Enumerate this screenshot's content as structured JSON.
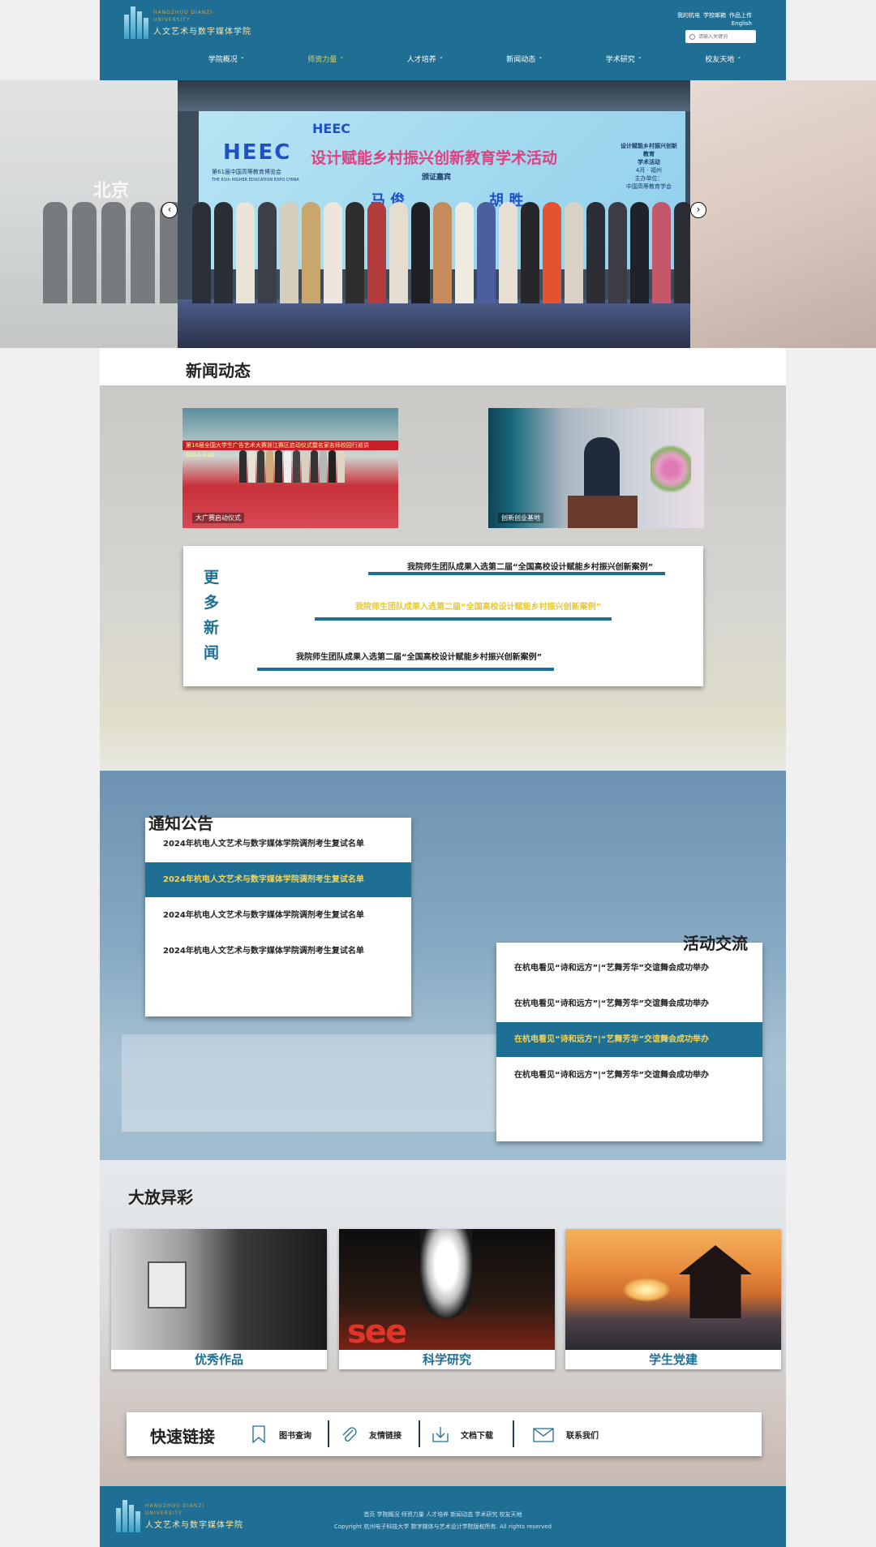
{
  "header": {
    "logo_en_line1": "HANGZHOU DIANZI",
    "logo_en_line2": "UNIVERSITY",
    "logo_cn": "人文艺术与数字媒体学院",
    "top_links": [
      "我的杭电",
      "学校邮箱",
      "作品上传"
    ],
    "lang_switch": "English",
    "search_placeholder": "请输入关键词"
  },
  "nav": {
    "items": [
      {
        "label": "学院概况",
        "active": false
      },
      {
        "label": "师资力量",
        "active": true
      },
      {
        "label": "人才培养",
        "active": false
      },
      {
        "label": "新闻动态",
        "active": false
      },
      {
        "label": "学术研究",
        "active": false
      },
      {
        "label": "校友天地",
        "active": false
      }
    ],
    "caret_icon": "chevron-down-icon"
  },
  "banner": {
    "heec": "HEEC",
    "expo": "第61届中国高等教育博览会",
    "expo_en": "THE 61th HIGHER EDUCATION EXPO CHINA",
    "title": "设计赋能乡村振兴创新教育学术活动",
    "subtitle": "颁证嘉宾",
    "name_1": "马 俊",
    "name_2": "胡 胜",
    "side_text": [
      "设计赋能乡村振兴创新教育",
      "学术活动",
      "4月 · 福州",
      "主办单位：",
      "中国高等教育学会"
    ],
    "left_sign": "北京",
    "prev_icon": "chevron-left-icon",
    "next_icon": "chevron-right-icon"
  },
  "news": {
    "section_title": "新闻动态",
    "image_captions": [
      "大广赛启动仪式",
      "创新创业基地"
    ],
    "image_1_banner": "第16届全国大学生广告艺术大赛浙江赛区启动仪式暨名家名师校园行巡讲 2024.4.16",
    "more_title": "更多新闻",
    "more_items": [
      "我院师生团队成果入选第二届“全国高校设计赋能乡村振兴创新案例”",
      "我院师生团队成果入选第二届“全国高校设计赋能乡村振兴创新案例”",
      "我院师生团队成果入选第二届“全国高校设计赋能乡村振兴创新案例”"
    ]
  },
  "notices": {
    "section_title": "通知公告",
    "items": [
      "2024年杭电人文艺术与数字媒体学院调剂考生复试名单",
      "2024年杭电人文艺术与数字媒体学院调剂考生复试名单",
      "2024年杭电人文艺术与数字媒体学院调剂考生复试名单",
      "2024年杭电人文艺术与数字媒体学院调剂考生复试名单"
    ],
    "active_index": 1
  },
  "activities": {
    "section_title": "活动交流",
    "items": [
      "在杭电看见“诗和远方”|“艺舞芳华”交谊舞会成功举办",
      "在杭电看见“诗和远方”|“艺舞芳华”交谊舞会成功举办",
      "在杭电看见“诗和远方”|“艺舞芳华”交谊舞会成功举办",
      "在杭电看见“诗和远方”|“艺舞芳华”交谊舞会成功举办"
    ],
    "active_index": 2
  },
  "showcase": {
    "section_title": "大放异彩",
    "cards": [
      {
        "label": "优秀作品"
      },
      {
        "label": "科学研究",
        "image_text": "see"
      },
      {
        "label": "学生党建"
      }
    ]
  },
  "quick_links": {
    "title": "快速链接",
    "items": [
      {
        "label": "图书查询",
        "icon": "bookmark-icon"
      },
      {
        "label": "友情链接",
        "icon": "paperclip-icon"
      },
      {
        "label": "文档下载",
        "icon": "download-icon"
      },
      {
        "label": "联系我们",
        "icon": "mail-icon"
      }
    ]
  },
  "footer": {
    "links": "首页 学院概况 师资力量 人才培养 新闻动态 学术研究 校友天地",
    "copyright": "Copyright 杭州电子科技大学 数字媒体与艺术设计学院版权所有. All rights reserved"
  },
  "colors": {
    "primary": "#1f6f95",
    "highlight": "#f2d45a",
    "nav_active": "#e8d15c"
  }
}
